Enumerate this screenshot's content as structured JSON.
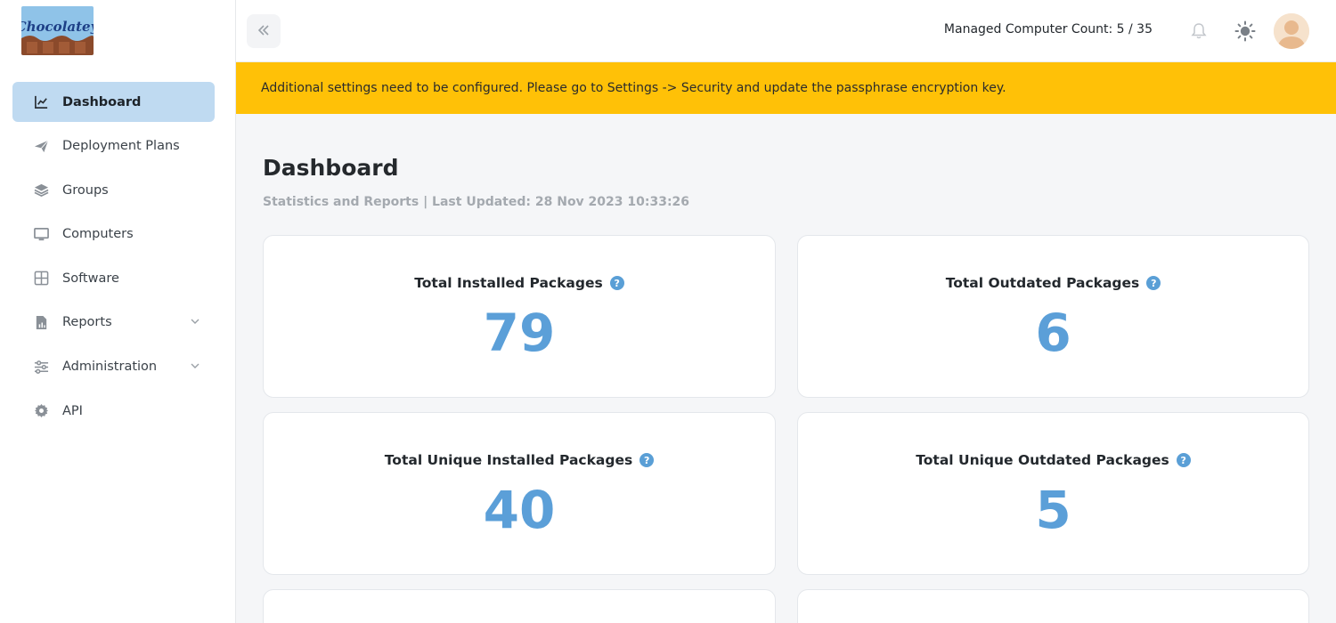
{
  "brand": {
    "logo_text": "Chocolatey"
  },
  "sidebar": {
    "items": [
      {
        "label": "Dashboard",
        "icon": "chart-line-icon",
        "active": true
      },
      {
        "label": "Deployment Plans",
        "icon": "paper-plane-icon"
      },
      {
        "label": "Groups",
        "icon": "layers-icon"
      },
      {
        "label": "Computers",
        "icon": "monitor-icon"
      },
      {
        "label": "Software",
        "icon": "grid-icon"
      },
      {
        "label": "Reports",
        "icon": "file-report-icon",
        "expandable": true
      },
      {
        "label": "Administration",
        "icon": "sliders-icon",
        "expandable": true
      },
      {
        "label": "API",
        "icon": "gear-icon"
      }
    ]
  },
  "header": {
    "managed_count": "Managed Computer Count: 5 / 35"
  },
  "banner": {
    "message": "Additional settings need to be configured. Please go to Settings -> Security and update the passphrase encryption key."
  },
  "main": {
    "title": "Dashboard",
    "subtitle": "Statistics and Reports | Last Updated: 28 Nov 2023 10:33:26",
    "cards": [
      {
        "title": "Total Installed Packages",
        "value": "79"
      },
      {
        "title": "Total Outdated Packages",
        "value": "6"
      },
      {
        "title": "Total Unique Installed Packages",
        "value": "40"
      },
      {
        "title": "Total Unique Outdated Packages",
        "value": "5"
      }
    ],
    "help_glyph": "?"
  },
  "colors": {
    "accent": "#5b9fd8",
    "banner": "#ffc107",
    "active_nav": "#bfdaf1"
  }
}
